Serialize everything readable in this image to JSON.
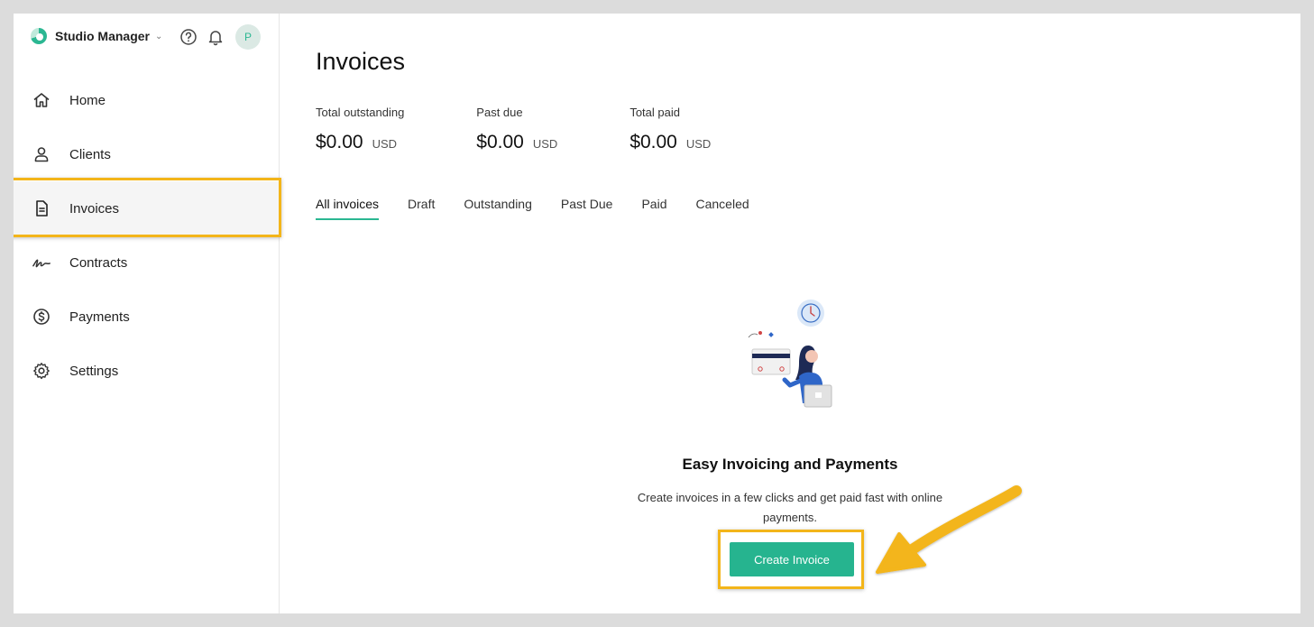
{
  "app": {
    "name": "Studio Manager",
    "avatar_initial": "P"
  },
  "sidebar": {
    "items": [
      {
        "label": "Home",
        "icon": "home-icon"
      },
      {
        "label": "Clients",
        "icon": "user-icon"
      },
      {
        "label": "Invoices",
        "icon": "document-icon",
        "active": true
      },
      {
        "label": "Contracts",
        "icon": "signature-icon"
      },
      {
        "label": "Payments",
        "icon": "dollar-circle-icon"
      },
      {
        "label": "Settings",
        "icon": "gear-icon"
      }
    ]
  },
  "main": {
    "title": "Invoices",
    "stats": [
      {
        "label": "Total outstanding",
        "amount": "$0.00",
        "currency": "USD"
      },
      {
        "label": "Past due",
        "amount": "$0.00",
        "currency": "USD"
      },
      {
        "label": "Total paid",
        "amount": "$0.00",
        "currency": "USD"
      }
    ],
    "tabs": [
      {
        "label": "All invoices",
        "active": true
      },
      {
        "label": "Draft"
      },
      {
        "label": "Outstanding"
      },
      {
        "label": "Past Due"
      },
      {
        "label": "Paid"
      },
      {
        "label": "Canceled"
      }
    ],
    "empty_state": {
      "title": "Easy Invoicing and Payments",
      "description": "Create invoices in a few clicks and get paid fast with online payments.",
      "button_label": "Create Invoice"
    }
  },
  "colors": {
    "accent": "#26b48f",
    "highlight": "#f3b51a"
  }
}
